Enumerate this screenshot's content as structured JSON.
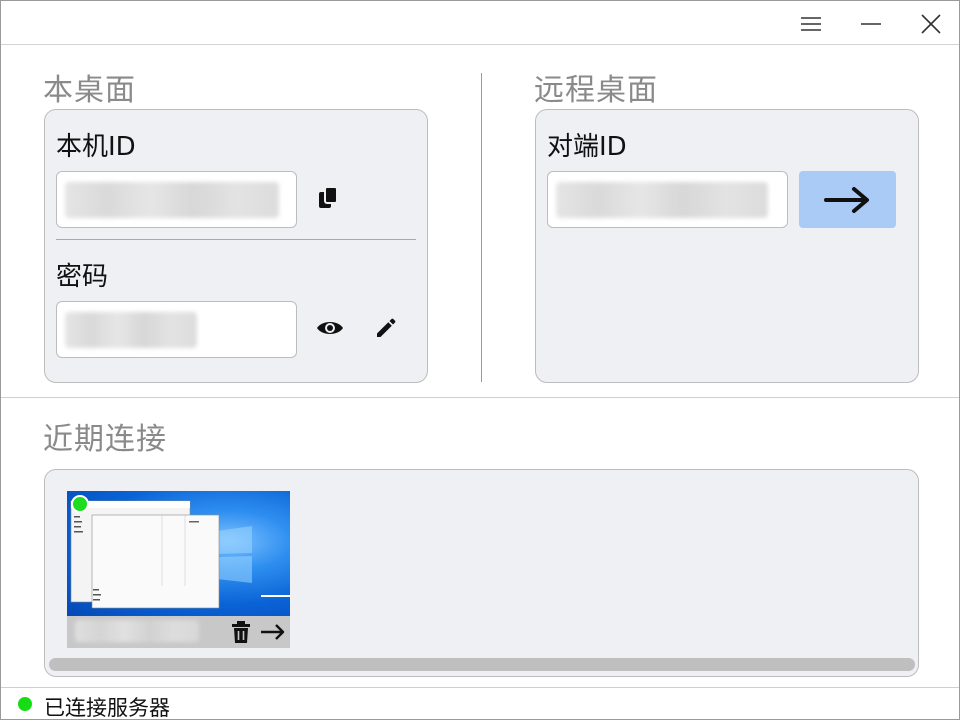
{
  "titlebar": {
    "menu_icon": "hamburger-menu-icon",
    "minimize_icon": "minimize-icon",
    "close_icon": "close-icon"
  },
  "local": {
    "section_title": "本桌面",
    "id_label": "本机ID",
    "id_value": "",
    "copy_icon": "copy-icon",
    "password_label": "密码",
    "password_value": "",
    "show_password_icon": "eye-icon",
    "edit_password_icon": "pencil-icon"
  },
  "remote": {
    "section_title": "远程桌面",
    "id_label": "对端ID",
    "id_value": "",
    "connect_icon": "arrow-right-icon",
    "accent_color": "#a9cbf5"
  },
  "recent": {
    "section_title": "近期连接",
    "sessions": [
      {
        "name": "",
        "online": true,
        "delete_icon": "trash-icon",
        "connect_icon": "arrow-right-icon"
      }
    ]
  },
  "status": {
    "text": "已连接服务器",
    "color": "#16dc16"
  }
}
